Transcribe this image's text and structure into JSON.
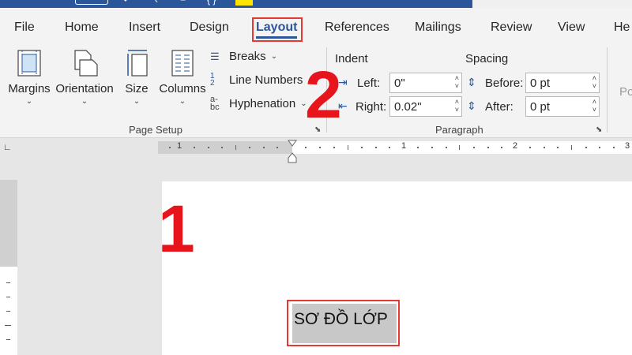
{
  "tabs": [
    "File",
    "Home",
    "Insert",
    "Design",
    "Layout",
    "References",
    "Mailings",
    "Review",
    "View",
    "He"
  ],
  "active_tab": "Layout",
  "page_setup": {
    "margins": "Margins",
    "orientation": "Orientation",
    "size": "Size",
    "columns": "Columns",
    "breaks": "Breaks",
    "line_numbers": "Line Numbers",
    "hyphenation": "Hyphenation",
    "group_label": "Page Setup"
  },
  "paragraph": {
    "indent_label": "Indent",
    "spacing_label": "Spacing",
    "left_label": "Left:",
    "left_value": "0\"",
    "right_label": "Right:",
    "right_value": "0.02\"",
    "before_label": "Before:",
    "before_value": "0 pt",
    "after_label": "After:",
    "after_value": "0 pt",
    "group_label": "Paragraph"
  },
  "ribbon_partial": "Po",
  "ruler_numbers": [
    "1",
    "1",
    "2",
    "3"
  ],
  "document": {
    "selected_text": "SƠ ĐỒ LỚP"
  },
  "annotations": {
    "step1": "1",
    "step2": "2"
  },
  "colors": {
    "accent": "#2b579a",
    "annotation": "#e8141c"
  }
}
